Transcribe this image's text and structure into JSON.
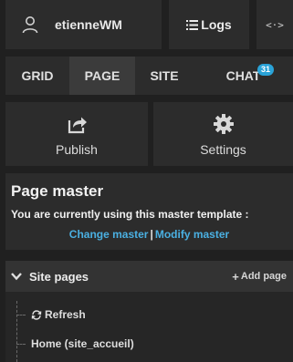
{
  "topbar": {
    "user_icon": "user-icon",
    "username": "etienneWM",
    "logs_icon": "list-icon",
    "logs_label": "Logs",
    "code_icon": "code-icon",
    "code_label": "<·>"
  },
  "tabs": [
    {
      "label": "GRID",
      "active": false
    },
    {
      "label": "PAGE",
      "active": true
    },
    {
      "label": "SITE",
      "active": false
    },
    {
      "label": "CHAT",
      "active": false,
      "badge": "31"
    }
  ],
  "actions": {
    "publish": {
      "label": "Publish",
      "icon": "share-icon"
    },
    "settings": {
      "label": "Settings",
      "icon": "gear-icon"
    }
  },
  "page_master": {
    "title": "Page master",
    "description": "You are currently using this master template :",
    "change_link": "Change master",
    "separator": "|",
    "modify_link": "Modify master"
  },
  "site_pages": {
    "title": "Site pages",
    "add_label": "Add page",
    "add_icon": "plus-icon",
    "items": [
      {
        "label": "Refresh",
        "icon": "refresh-icon"
      },
      {
        "label": "Home (site_accueil)"
      }
    ]
  },
  "colors": {
    "background": "#202020",
    "panel": "#2c2c2c",
    "link": "#4ab0e2",
    "badge": "#2aa3d8"
  }
}
